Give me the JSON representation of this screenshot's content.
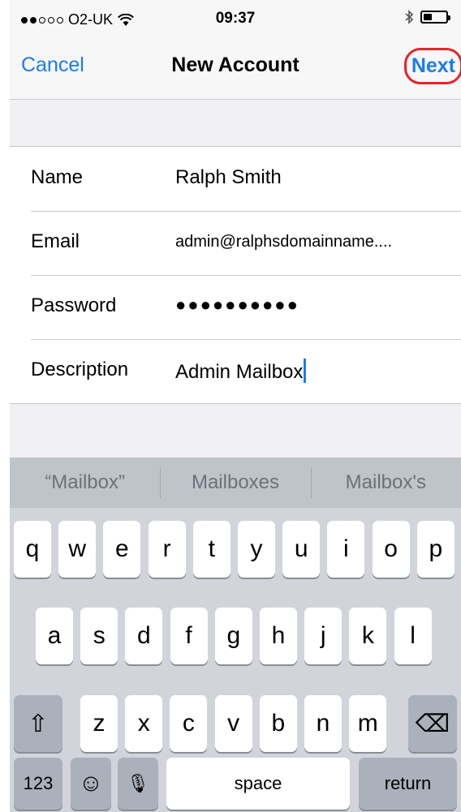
{
  "status_bar": {
    "carrier": "O2-UK",
    "signal_bars_filled": 2,
    "signal_bars_total": 5,
    "time": "09:37",
    "battery_level_percent": 40
  },
  "nav": {
    "cancel_label": "Cancel",
    "title": "New Account",
    "next_label": "Next",
    "highlight_color": "#e8232b",
    "accent_color": "#1a7cf5"
  },
  "form": {
    "rows": [
      {
        "label": "Name",
        "value": "Ralph Smith"
      },
      {
        "label": "Email",
        "value": "admin@ralphsdomainname...."
      },
      {
        "label": "Password",
        "value": "●●●●●●●●●●"
      },
      {
        "label": "Description",
        "value": "Admin Mailbox"
      }
    ]
  },
  "keyboard": {
    "suggestions": [
      "“Mailbox”",
      "Mailboxes",
      "Mailbox's"
    ],
    "row1": [
      "q",
      "w",
      "e",
      "r",
      "t",
      "y",
      "u",
      "i",
      "o",
      "p"
    ],
    "row2": [
      "a",
      "s",
      "d",
      "f",
      "g",
      "h",
      "j",
      "k",
      "l"
    ],
    "row3": [
      "z",
      "x",
      "c",
      "v",
      "b",
      "n",
      "m"
    ],
    "shift_glyph": "⇧",
    "delete_glyph": "⌫",
    "numbers_label": "123",
    "emoji_glyph": "☺",
    "mic_glyph": "🎙",
    "space_label": "space",
    "return_label": "return"
  }
}
